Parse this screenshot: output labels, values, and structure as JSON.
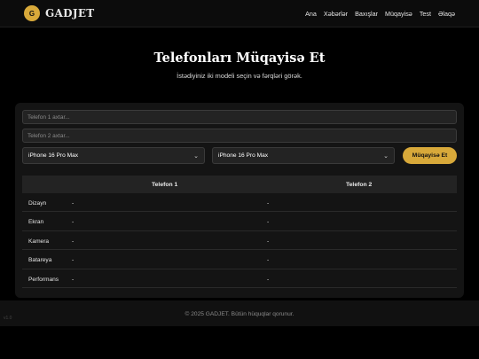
{
  "header": {
    "logo_letter": "G",
    "brand": "GADJET",
    "nav": [
      "Ana",
      "Xəbərlər",
      "Baxışlar",
      "Müqayisə",
      "Test",
      "Əlaqə"
    ]
  },
  "main": {
    "title": "Telefonları Müqayisə Et",
    "subtitle": "İstədiyiniz iki modeli seçin və fərqləri görək."
  },
  "compare": {
    "search1_placeholder": "Telefon 1 axtar...",
    "search2_placeholder": "Telefon 2 axtar...",
    "select1_value": "iPhone 16 Pro Max",
    "select2_value": "iPhone 16 Pro Max",
    "button_label": "Müqayisə Et"
  },
  "table": {
    "columns": [
      "Telefon 1",
      "Telefon 2"
    ],
    "rows": [
      {
        "label": "Dizayn",
        "v1": "-",
        "v2": "-"
      },
      {
        "label": "Ekran",
        "v1": "-",
        "v2": "-"
      },
      {
        "label": "Kamera",
        "v1": "-",
        "v2": "-"
      },
      {
        "label": "Batareya",
        "v1": "-",
        "v2": "-"
      },
      {
        "label": "Performans",
        "v1": "-",
        "v2": "-"
      }
    ]
  },
  "footer": {
    "copyright": "© 2025 GADJET. Bütün hüquqlar qorunur.",
    "version": "v1.0"
  },
  "colors": {
    "accent": "#d8a93a",
    "background": "#000000",
    "card": "#141414"
  }
}
